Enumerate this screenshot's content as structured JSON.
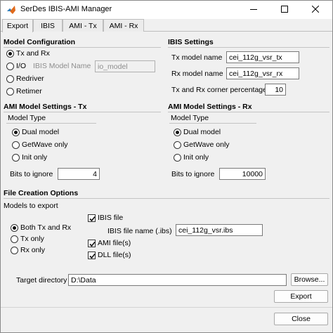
{
  "window": {
    "title": "SerDes IBIS-AMI Manager"
  },
  "tabs": [
    {
      "label": "Export"
    },
    {
      "label": "IBIS"
    },
    {
      "label": "AMI - Tx"
    },
    {
      "label": "AMI - Rx"
    }
  ],
  "model_config": {
    "title": "Model Configuration",
    "options": [
      {
        "label": "Tx and Rx",
        "selected": true
      },
      {
        "label": "I/O",
        "selected": false
      },
      {
        "label": "Redriver",
        "selected": false
      },
      {
        "label": "Retimer",
        "selected": false
      }
    ],
    "ibis_model_name_label": "IBIS Model Name",
    "ibis_model_name_value": "io_model"
  },
  "ibis_settings": {
    "title": "IBIS Settings",
    "tx_label": "Tx model name",
    "tx_value": "cei_112g_vsr_tx",
    "rx_label": "Rx model name",
    "rx_value": "cei_112g_vsr_rx",
    "corner_label": "Tx and Rx corner percentage",
    "corner_value": "10"
  },
  "ami_tx": {
    "title": "AMI Model Settings - Tx",
    "model_type_label": "Model Type",
    "options": [
      {
        "label": "Dual model",
        "selected": true
      },
      {
        "label": "GetWave only",
        "selected": false
      },
      {
        "label": "Init only",
        "selected": false
      }
    ],
    "bits_label": "Bits to ignore",
    "bits_value": "4"
  },
  "ami_rx": {
    "title": "AMI Model Settings - Rx",
    "model_type_label": "Model Type",
    "options": [
      {
        "label": "Dual model",
        "selected": true
      },
      {
        "label": "GetWave only",
        "selected": false
      },
      {
        "label": "Init only",
        "selected": false
      }
    ],
    "bits_label": "Bits to ignore",
    "bits_value": "10000"
  },
  "file_creation": {
    "title": "File Creation Options",
    "models_label": "Models to export",
    "options": [
      {
        "label": "Both Tx and Rx",
        "selected": true
      },
      {
        "label": "Tx only",
        "selected": false
      },
      {
        "label": "Rx only",
        "selected": false
      }
    ],
    "ibis_file_label": "IBIS file",
    "ibis_file_name_label": "IBIS file name (.ibs)",
    "ibis_file_name_value": "cei_112g_vsr.ibs",
    "ami_files_label": "AMI file(s)",
    "dll_files_label": "DLL file(s)",
    "target_label": "Target directory",
    "target_value": "D:\\Data",
    "browse_label": "Browse...",
    "export_label": "Export"
  },
  "footer": {
    "close_label": "Close"
  }
}
